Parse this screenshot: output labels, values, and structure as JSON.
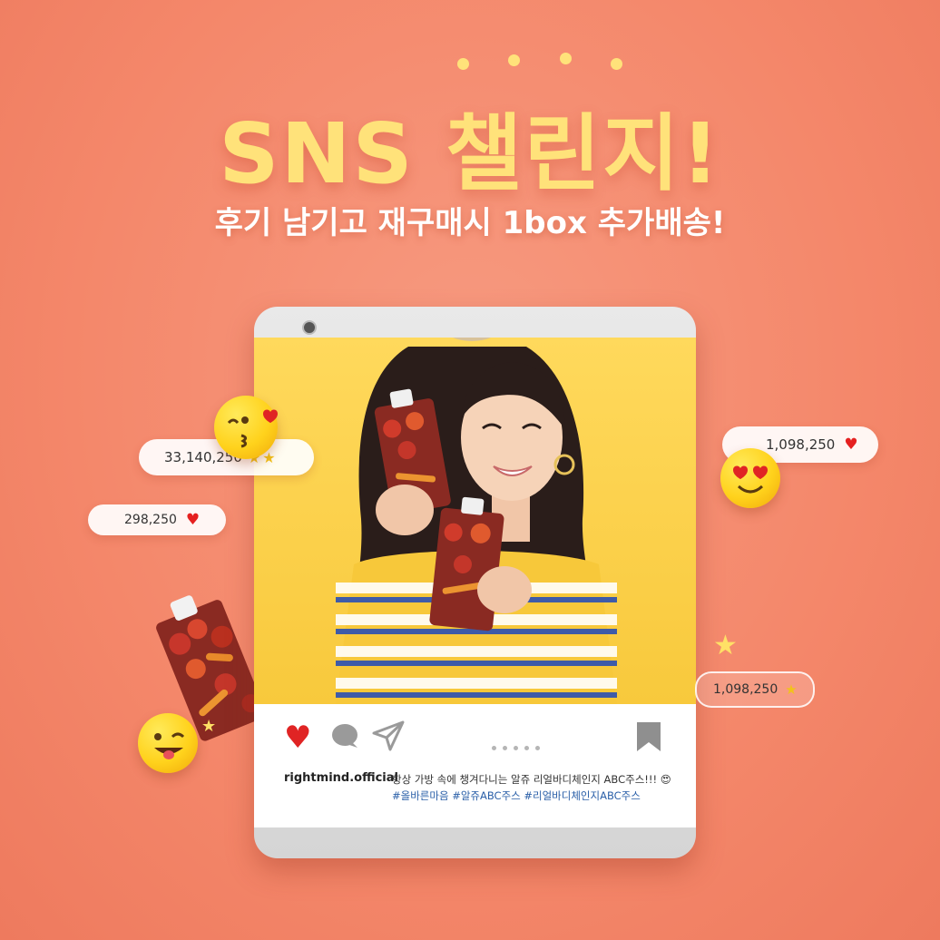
{
  "title": "SNS 챌린지!",
  "subtitle": "후기 남기고 재구매시 1box 추가배송!",
  "colors": {
    "background": "#f4876a",
    "title": "#ffe27a",
    "photo_bg": "#ffd95c",
    "heart": "#e02424",
    "star": "#f2c21b",
    "hashtag": "#2a5fa8"
  },
  "badges": {
    "left_top": "33,140,250",
    "left_small": "298,250",
    "right_top": "1,098,250",
    "right_bottom": "1,098,250"
  },
  "post": {
    "username": "rightmind.official",
    "caption": "항상 가방 속에 챙겨다니는 알쥬 리얼바디체인지 ABC주스!!! 😍",
    "hashtags": "#올바른마음 #알쥬ABC주스 #리얼바디체인지ABC주스"
  },
  "icons": {
    "like": "heart-icon",
    "comment": "comment-icon",
    "share": "send-icon",
    "save": "bookmark-icon",
    "decor": [
      "kiss-emoji-icon",
      "heart-eyes-emoji-icon",
      "winking-emoji-icon",
      "star-icon",
      "heart-icon"
    ]
  },
  "pager": {
    "total": 5
  }
}
